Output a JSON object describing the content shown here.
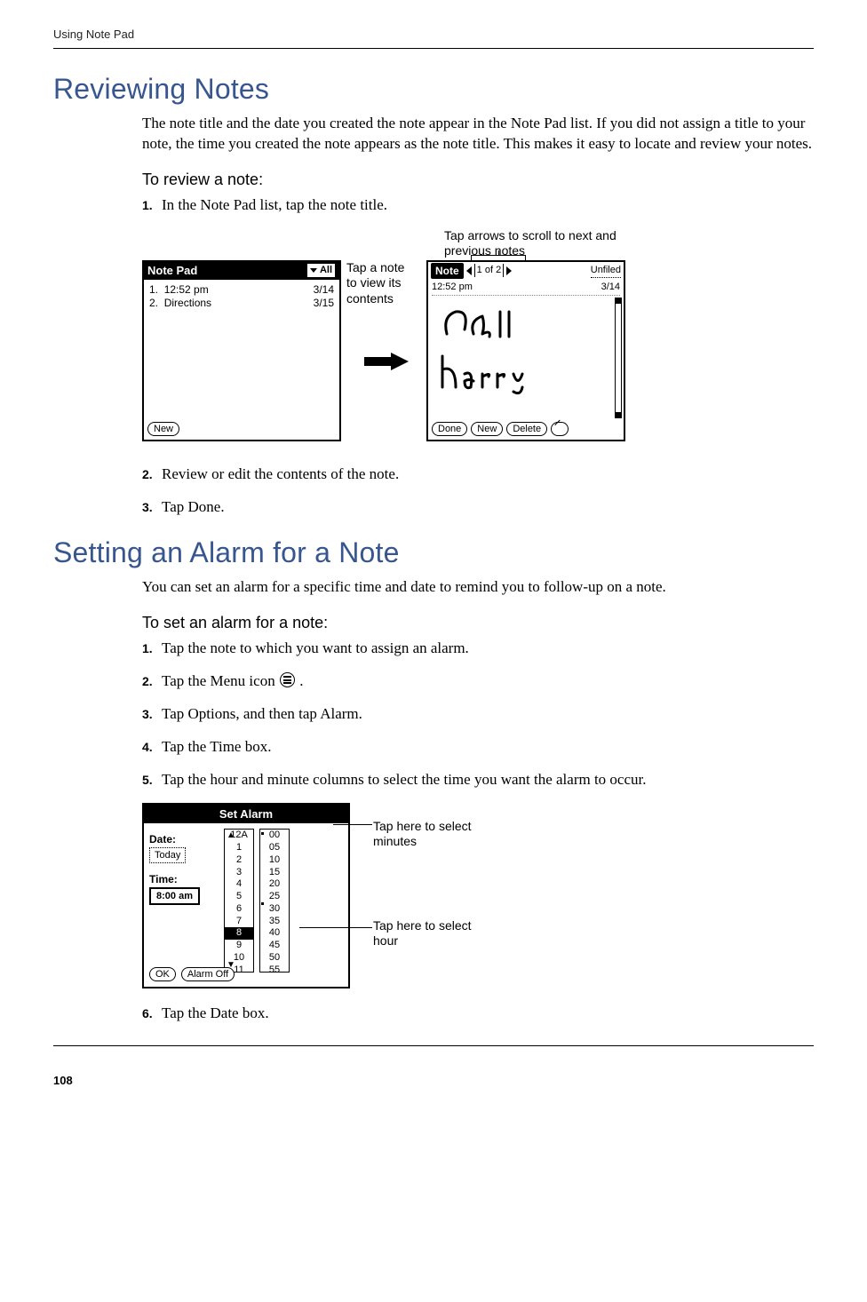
{
  "running_head": "Using Note Pad",
  "page_number": "108",
  "section1": {
    "title": "Reviewing Notes",
    "intro": "The note title and the date you created the note appear in the Note Pad list. If you did not assign a title to your note, the time you created the note appears as the note title. This makes it easy to locate and review your notes.",
    "subhead": "To review a note:",
    "steps": [
      "In the Note Pad list, tap the note title.",
      "Review or edit the contents of the note.",
      "Tap Done."
    ],
    "fig": {
      "callout_left": "Tap a note to view its contents",
      "callout_top": "Tap arrows to scroll to next and previous notes",
      "screen_list": {
        "title": "Note Pad",
        "category": "All",
        "rows": [
          {
            "num": "1.",
            "title": "12:52 pm",
            "date": "3/14"
          },
          {
            "num": "2.",
            "title": "Directions",
            "date": "3/15"
          }
        ],
        "new_btn": "New"
      },
      "screen_note": {
        "label": "Note",
        "counter": "1 of 2",
        "category": "Unfiled",
        "time": "12:52 pm",
        "date": "3/14",
        "handwriting_line1": "Call",
        "handwriting_line2": "Harry",
        "done_btn": "Done",
        "new_btn": "New",
        "delete_btn": "Delete"
      }
    }
  },
  "section2": {
    "title": "Setting an Alarm for a Note",
    "intro": "You can set an alarm for a specific time and date to remind you to follow-up on a note.",
    "subhead": "To set an alarm for a note:",
    "steps": [
      "Tap the note to which you want to assign an alarm.",
      "Tap the Menu icon   .",
      "Tap Options, and then tap Alarm.",
      "Tap the Time box.",
      "Tap the hour and minute columns to select the time you want the alarm to occur.",
      "Tap the Date box."
    ],
    "fig": {
      "title": "Set Alarm",
      "date_label": "Date:",
      "date_value": "Today",
      "time_label": "Time:",
      "time_value": "8:00 am",
      "ok_btn": "OK",
      "alarm_off_btn": "Alarm Off",
      "hours": [
        "12A",
        "1",
        "2",
        "3",
        "4",
        "5",
        "6",
        "7",
        "8",
        "9",
        "10",
        "11"
      ],
      "selected_hour": "8",
      "minutes": [
        "00",
        "05",
        "10",
        "15",
        "20",
        "25",
        "30",
        "35",
        "40",
        "45",
        "50",
        "55"
      ],
      "selected_minutes_markers": [
        "00",
        "30"
      ],
      "callout_min": "Tap here to select minutes",
      "callout_hour": "Tap here to select hour"
    }
  }
}
